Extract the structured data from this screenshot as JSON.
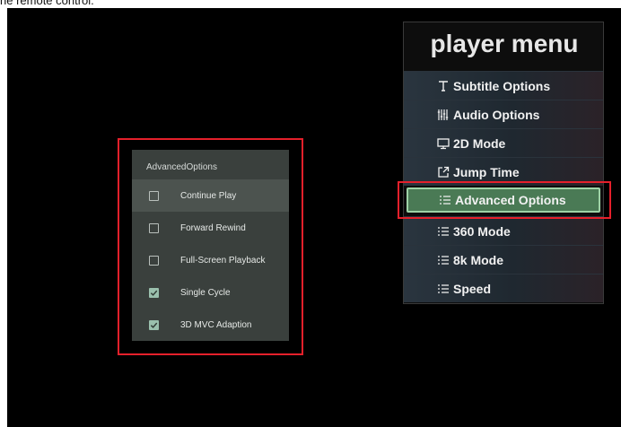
{
  "caption": {
    "text": "he remote control."
  },
  "advanced_dialog": {
    "title": "AdvancedOptions",
    "items": [
      {
        "label": "Continue Play",
        "checked": false,
        "selected": true
      },
      {
        "label": "Forward Rewind",
        "checked": false,
        "selected": false
      },
      {
        "label": "Full-Screen Playback",
        "checked": false,
        "selected": false
      },
      {
        "label": "Single Cycle",
        "checked": true,
        "selected": false
      },
      {
        "label": "3D MVC Adaption",
        "checked": true,
        "selected": false
      }
    ]
  },
  "player_menu": {
    "title": "player menu",
    "items": [
      {
        "label": "Subtitle Options",
        "icon": "text-icon"
      },
      {
        "label": "Audio Options",
        "icon": "equalizer-icon"
      },
      {
        "label": "2D Mode",
        "icon": "monitor-icon"
      },
      {
        "label": "Jump Time",
        "icon": "external-link-icon"
      },
      {
        "label": "Advanced Options",
        "icon": "list-icon",
        "highlighted": true
      },
      {
        "label": "360 Mode",
        "icon": "list-icon"
      },
      {
        "label": "8k Mode",
        "icon": "list-icon"
      },
      {
        "label": "Speed",
        "icon": "list-icon"
      }
    ]
  },
  "colors": {
    "annotation_red": "#e5202b",
    "highlight_green": "#4a7a55",
    "checkbox_checked": "#9ac0ad"
  }
}
